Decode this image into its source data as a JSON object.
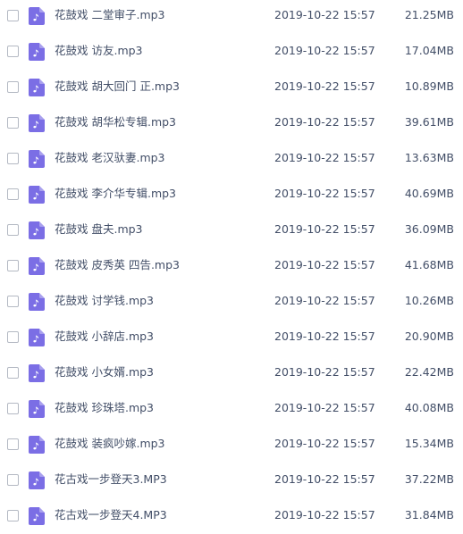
{
  "colors": {
    "audio_icon": "#7b6ee5",
    "text": "#424e67",
    "checkbox_border": "#b4b9c3"
  },
  "file_icon_name": "music-note-icon",
  "files": [
    {
      "name": "花鼓戏 二堂审子.mp3",
      "date": "2019-10-22 15:57",
      "size": "21.25MB"
    },
    {
      "name": "花鼓戏 访友.mp3",
      "date": "2019-10-22 15:57",
      "size": "17.04MB"
    },
    {
      "name": "花鼓戏 胡大回门 正.mp3",
      "date": "2019-10-22 15:57",
      "size": "10.89MB"
    },
    {
      "name": "花鼓戏 胡华松专辑.mp3",
      "date": "2019-10-22 15:57",
      "size": "39.61MB"
    },
    {
      "name": "花鼓戏 老汉驮妻.mp3",
      "date": "2019-10-22 15:57",
      "size": "13.63MB"
    },
    {
      "name": "花鼓戏 李介华专辑.mp3",
      "date": "2019-10-22 15:57",
      "size": "40.69MB"
    },
    {
      "name": "花鼓戏 盘夫.mp3",
      "date": "2019-10-22 15:57",
      "size": "36.09MB"
    },
    {
      "name": "花鼓戏 皮秀英 四告.mp3",
      "date": "2019-10-22 15:57",
      "size": "41.68MB"
    },
    {
      "name": "花鼓戏 讨学钱.mp3",
      "date": "2019-10-22 15:57",
      "size": "10.26MB"
    },
    {
      "name": "花鼓戏 小辞店.mp3",
      "date": "2019-10-22 15:57",
      "size": "20.90MB"
    },
    {
      "name": "花鼓戏 小女婿.mp3",
      "date": "2019-10-22 15:57",
      "size": "22.42MB"
    },
    {
      "name": "花鼓戏 珍珠塔.mp3",
      "date": "2019-10-22 15:57",
      "size": "40.08MB"
    },
    {
      "name": "花鼓戏 装疯吵嫁.mp3",
      "date": "2019-10-22 15:57",
      "size": "15.34MB"
    },
    {
      "name": "花古戏一步登天3.MP3",
      "date": "2019-10-22 15:57",
      "size": "37.22MB"
    },
    {
      "name": "花古戏一步登天4.MP3",
      "date": "2019-10-22 15:57",
      "size": "31.84MB"
    }
  ]
}
